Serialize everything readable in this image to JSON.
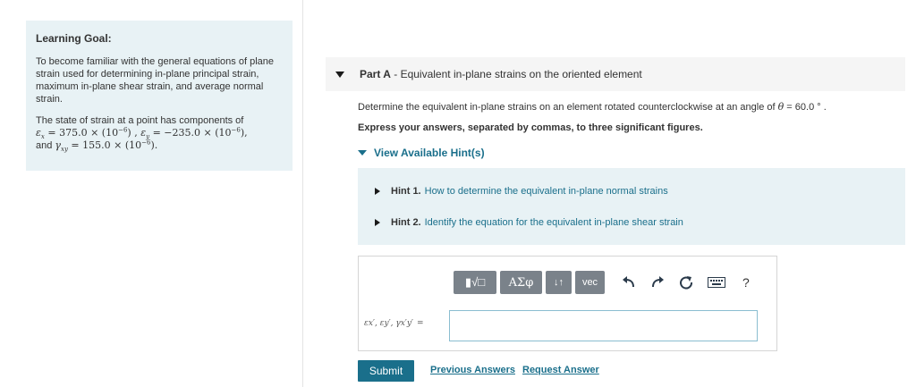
{
  "learning_goal": {
    "heading": "Learning Goal:",
    "text": "To become familiar with the general equations of plane strain used for determining in-plane principal strain, maximum in-plane shear strain, and average normal strain.",
    "state_intro": "The state of strain at a point has components of",
    "eps_x_value": "375.0",
    "eps_y_value": "−235.0",
    "gamma_xy_value": "155.0",
    "times_text": "× (10",
    "exp": "−6",
    "and_text": "and"
  },
  "part": {
    "prefix": "Part A",
    "title": " - Equivalent in-plane strains on the oriented element"
  },
  "question": {
    "text": "Determine the equivalent in-plane strains on an element rotated counterclockwise at an angle of",
    "theta": "θ",
    "value": " = 60.0 ° ."
  },
  "instruction": "Express your answers, separated by commas, to three significant figures.",
  "hints_toggle": "View Available Hint(s)",
  "hints": [
    {
      "num": "Hint 1.",
      "text": "How to determine the equivalent in-plane normal strains"
    },
    {
      "num": "Hint 2.",
      "text": "Identify the equation for the equivalent in-plane shear strain"
    }
  ],
  "toolbar": {
    "template_label": "▮√□",
    "greek_label": "ΑΣφ",
    "arrows_label": "↓↑",
    "vec_label": "vec",
    "help_label": "?",
    "icons": [
      "undo-icon",
      "redo-icon",
      "reset-icon",
      "keyboard-icon"
    ]
  },
  "answer": {
    "label": "εx′, εy′, γx′y′",
    "equals": "=",
    "value": ""
  },
  "actions": {
    "submit": "Submit",
    "previous": "Previous Answers",
    "request": "Request Answer"
  },
  "colors": {
    "accent": "#1a6f8b",
    "panel_bg": "#e8f2f5",
    "toolbar_btn": "#7a828a"
  }
}
